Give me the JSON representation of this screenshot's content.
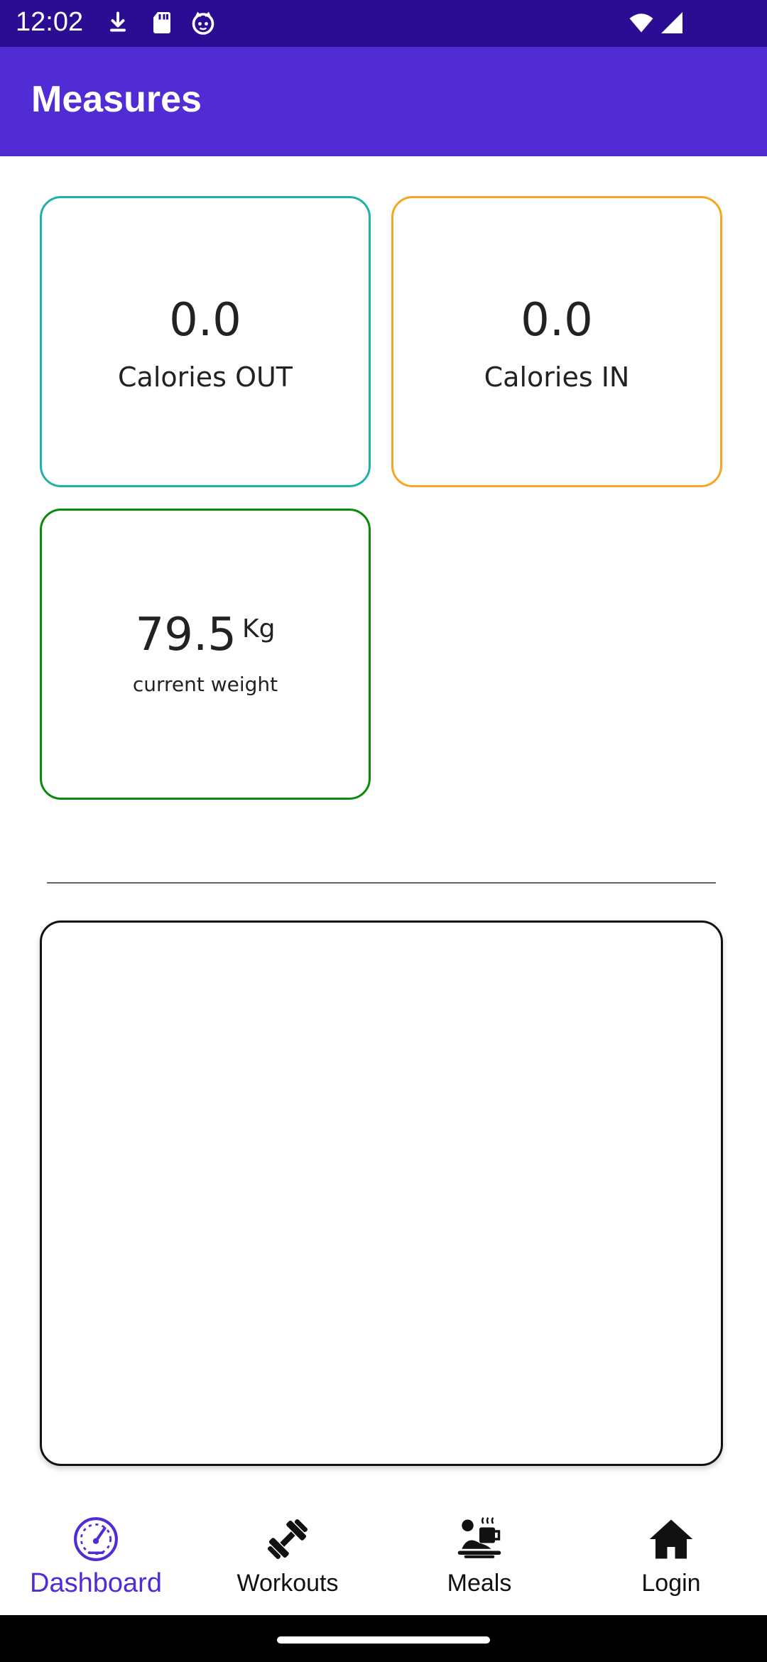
{
  "status_bar": {
    "time": "12:02",
    "icons": [
      "download-icon",
      "sd-card-icon",
      "cat-face-icon",
      "wifi-icon",
      "signal-icon"
    ]
  },
  "app_bar": {
    "title": "Measures"
  },
  "cards": {
    "calories_out": {
      "value": "0.0",
      "label": "Calories OUT",
      "border_color": "#20b2aa"
    },
    "calories_in": {
      "value": "0.0",
      "label": "Calories IN",
      "border_color": "#f5a623"
    },
    "weight": {
      "value": "79.5",
      "unit": "Kg",
      "label": "current weight",
      "border_color": "#0a8a0a"
    }
  },
  "bottom_nav": {
    "items": [
      {
        "label": "Dashboard",
        "icon": "dashboard-gauge-icon",
        "active": true
      },
      {
        "label": "Workouts",
        "icon": "dumbbell-icon",
        "active": false
      },
      {
        "label": "Meals",
        "icon": "meal-icon",
        "active": false
      },
      {
        "label": "Login",
        "icon": "home-icon",
        "active": false
      }
    ]
  },
  "colors": {
    "status_bar": "#2a0d93",
    "app_bar": "#512bd4",
    "accent": "#512bd4"
  }
}
